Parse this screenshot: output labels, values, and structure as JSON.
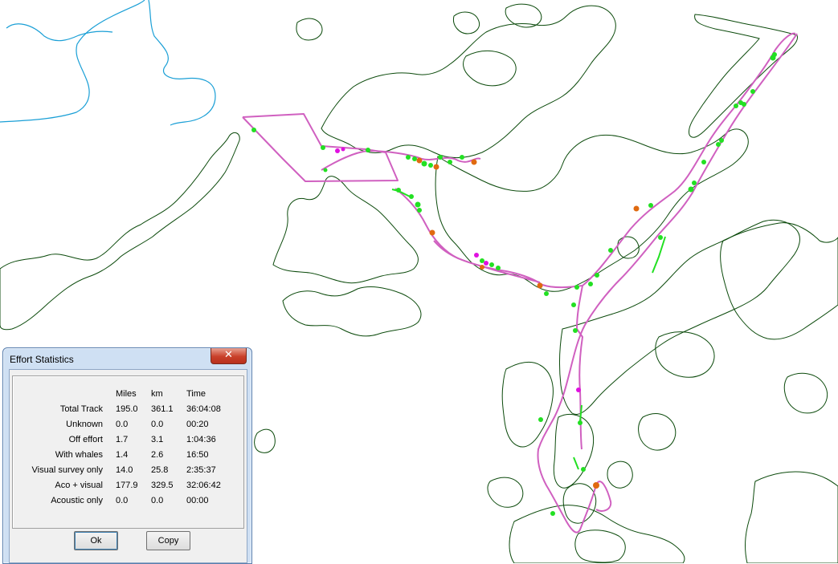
{
  "map": {
    "colors": {
      "coast": "#0b4a0b",
      "river": "#1a9fd6",
      "track": "#d060c0",
      "on_effort": "#22e022",
      "orange_marker": "#e06a10",
      "magenta_marker": "#e010e0"
    }
  },
  "dialog": {
    "title": "Effort Statistics",
    "close_icon": "close-icon",
    "columns": [
      "Miles",
      "km",
      "Time"
    ],
    "rows": [
      {
        "label": "Total Track",
        "miles": "195.0",
        "km": "361.1",
        "time": "36:04:08"
      },
      {
        "label": "Unknown",
        "miles": "0.0",
        "km": "0.0",
        "time": "00:20"
      },
      {
        "label": "Off effort",
        "miles": "1.7",
        "km": "3.1",
        "time": "1:04:36"
      },
      {
        "label": "With whales",
        "miles": "1.4",
        "km": "2.6",
        "time": "16:50"
      },
      {
        "label": "Visual survey only",
        "miles": "14.0",
        "km": "25.8",
        "time": "2:35:37"
      },
      {
        "label": "Aco + visual",
        "miles": "177.9",
        "km": "329.5",
        "time": "32:06:42"
      },
      {
        "label": "Acoustic only",
        "miles": "0.0",
        "km": "0.0",
        "time": "00:00"
      }
    ],
    "ok_label": "Ok",
    "copy_label": "Copy"
  }
}
